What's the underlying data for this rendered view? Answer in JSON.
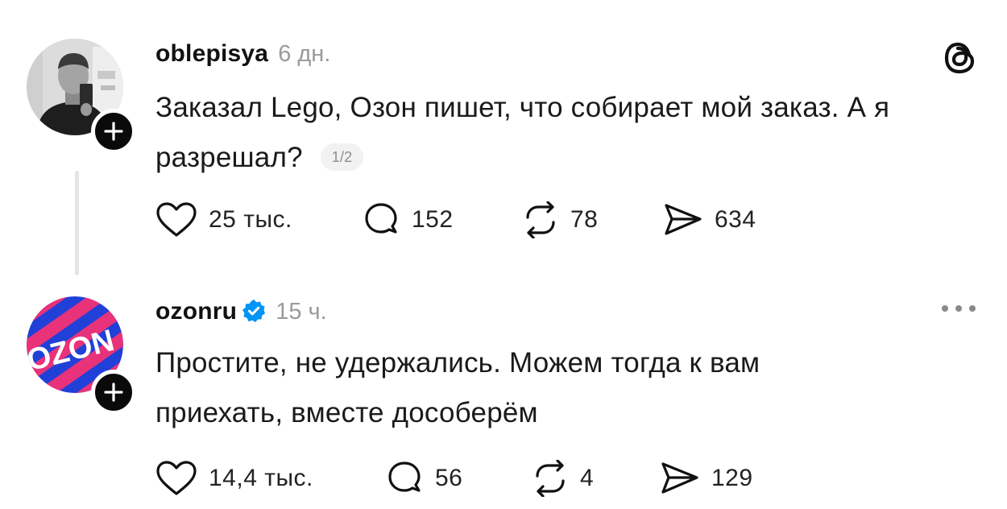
{
  "posts": [
    {
      "username": "oblepisya",
      "time": "6 дн.",
      "text": "Заказал Lego, Озон пишет, что собирает мой заказ. А я разрешал?",
      "page_indicator": "1/2",
      "likes": "25 тыс.",
      "replies": "152",
      "reposts": "78",
      "shares": "634"
    },
    {
      "username": "ozonru",
      "verified": true,
      "time": "15 ч.",
      "text": "Простите, не удержались. Можем тогда к вам приехать, вместе дособерём",
      "likes": "14,4 тыс.",
      "replies": "56",
      "reposts": "4",
      "shares": "129"
    }
  ],
  "avatar_text": {
    "ozon_logo": "OZON"
  },
  "colors": {
    "ozon_blue": "#2040d8",
    "ozon_pink": "#e8327a",
    "verified_blue": "#0095f6",
    "text": "#1a1a1a",
    "muted": "#9a9a9a"
  },
  "icons": [
    "threads-logo-icon",
    "heart-icon",
    "comment-icon",
    "repost-icon",
    "share-icon",
    "more-icon",
    "plus-icon",
    "verified-icon"
  ]
}
